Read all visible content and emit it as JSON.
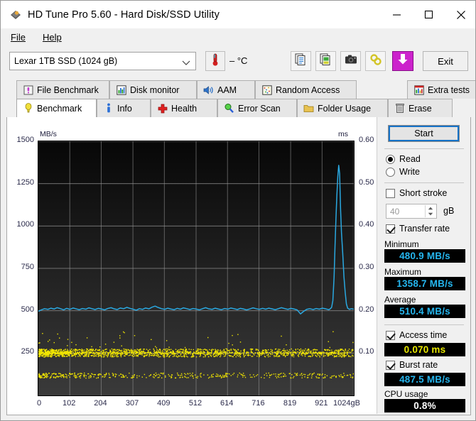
{
  "window": {
    "title": "HD Tune Pro 5.60 - Hard Disk/SSD Utility",
    "app_icon": "hdtune-logo-icon",
    "minimize": "─",
    "maximize": "□",
    "close": "✕"
  },
  "menubar": {
    "items": [
      {
        "label": "File",
        "mnemonic": "F"
      },
      {
        "label": "Help",
        "mnemonic": "H"
      }
    ]
  },
  "toolbar": {
    "drive": {
      "value": "Lexar 1TB SSD (1024 gB)",
      "icon": "chevron-down-icon"
    },
    "temperature": {
      "icon": "thermometer-icon",
      "value": "– °C"
    },
    "buttons": [
      {
        "name": "copy-to-clipboard-button",
        "icon": "copy-document-icon"
      },
      {
        "name": "copy-image-button",
        "icon": "copy-image-icon"
      },
      {
        "name": "screenshot-button",
        "icon": "camera-icon"
      },
      {
        "name": "link-button",
        "icon": "chain-link-icon"
      },
      {
        "name": "save-button",
        "icon": "down-arrow-icon"
      }
    ],
    "exit_label": "Exit"
  },
  "tabs": {
    "row1": [
      {
        "label": "File Benchmark",
        "icon": "file-benchmark-icon",
        "active": false
      },
      {
        "label": "Disk monitor",
        "icon": "bar-chart-icon",
        "active": false
      },
      {
        "label": "AAM",
        "icon": "speaker-icon",
        "active": false
      },
      {
        "label": "Random Access",
        "icon": "scatter-icon",
        "active": false
      },
      {
        "label": "Extra tests",
        "icon": "extra-chart-icon",
        "active": false
      }
    ],
    "row2": [
      {
        "label": "Benchmark",
        "icon": "bulb-icon",
        "active": true
      },
      {
        "label": "Info",
        "icon": "info-icon",
        "active": false
      },
      {
        "label": "Health",
        "icon": "red-cross-icon",
        "active": false
      },
      {
        "label": "Error Scan",
        "icon": "magnifier-icon",
        "active": false
      },
      {
        "label": "Folder Usage",
        "icon": "folder-icon",
        "active": false
      },
      {
        "label": "Erase",
        "icon": "trash-icon",
        "active": false
      }
    ]
  },
  "panel": {
    "start_label": "Start",
    "mode": {
      "read_label": "Read",
      "write_label": "Write",
      "selected": "Read"
    },
    "short_stroke": {
      "label": "Short stroke",
      "checked": false,
      "value": "40",
      "unit": "gB"
    },
    "transfer_rate": {
      "label": "Transfer rate",
      "checked": true
    },
    "results": [
      {
        "label": "Minimum",
        "value": "480.9 MB/s",
        "color": "#25b6ef"
      },
      {
        "label": "Maximum",
        "value": "1358.7 MB/s",
        "color": "#25b6ef"
      },
      {
        "label": "Average",
        "value": "510.4 MB/s",
        "color": "#25b6ef"
      }
    ],
    "access_time": {
      "label": "Access time",
      "checked": true,
      "value": "0.070 ms",
      "color": "#e8e800"
    },
    "burst_rate": {
      "label": "Burst rate",
      "checked": true,
      "value": "487.5 MB/s",
      "color": "#ffffff"
    },
    "cpu_usage": {
      "label": "CPU usage",
      "value": "0.8%",
      "color": "#ffffff"
    }
  },
  "chart_data": {
    "type": "line",
    "title": "",
    "xlabel": "gB",
    "ylabel": "MB/s",
    "y2label": "ms",
    "xlim": [
      0,
      1024
    ],
    "ylim": [
      0,
      1500
    ],
    "y2lim": [
      0,
      0.6
    ],
    "grid": true,
    "legend": "none",
    "background": "#0a0a0a",
    "x_ticks": [
      0,
      102,
      204,
      307,
      409,
      512,
      614,
      716,
      819,
      921,
      1024
    ],
    "x_tick_labels": [
      "0",
      "102",
      "204",
      "307",
      "409",
      "512",
      "614",
      "716",
      "819",
      "921",
      "1024gB"
    ],
    "y_ticks": [
      0,
      250,
      500,
      750,
      1000,
      1250,
      1500
    ],
    "y_tick_labels": [
      "",
      "250",
      "500",
      "750",
      "1000",
      "1250",
      "1500"
    ],
    "y2_ticks": [
      0.0,
      0.1,
      0.2,
      0.3,
      0.4,
      0.5,
      0.6
    ],
    "y2_tick_labels": [
      "",
      "0.10",
      "0.20",
      "0.30",
      "0.40",
      "0.50",
      "0.60"
    ],
    "series": [
      {
        "name": "Transfer rate",
        "type": "line",
        "color": "#2aa8e0",
        "axis": "left",
        "unit": "MB/s",
        "x": [
          0,
          10,
          20,
          31,
          41,
          51,
          61,
          72,
          82,
          92,
          102,
          113,
          123,
          133,
          143,
          154,
          164,
          174,
          184,
          195,
          205,
          215,
          225,
          236,
          246,
          256,
          266,
          277,
          287,
          297,
          307,
          318,
          328,
          338,
          348,
          359,
          369,
          379,
          389,
          400,
          410,
          420,
          430,
          441,
          451,
          461,
          471,
          482,
          492,
          502,
          512,
          523,
          533,
          543,
          553,
          564,
          574,
          584,
          594,
          605,
          615,
          625,
          635,
          646,
          656,
          666,
          676,
          687,
          697,
          707,
          717,
          728,
          738,
          748,
          758,
          769,
          779,
          789,
          799,
          810,
          820,
          830,
          840,
          851,
          861,
          871,
          881,
          892,
          902,
          912,
          922,
          933,
          943,
          948,
          952,
          956,
          960,
          963,
          966,
          969,
          972,
          975,
          978,
          981,
          984,
          988,
          992,
          996,
          1000,
          1004,
          1010,
          1016,
          1024
        ],
        "y": [
          497,
          505,
          512,
          508,
          515,
          510,
          518,
          512,
          505,
          514,
          508,
          516,
          511,
          506,
          513,
          509,
          517,
          512,
          507,
          514,
          510,
          505,
          513,
          518,
          511,
          507,
          516,
          512,
          520,
          514,
          509,
          503,
          512,
          508,
          516,
          511,
          521,
          527,
          519,
          512,
          508,
          515,
          510,
          506,
          514,
          509,
          517,
          512,
          507,
          513,
          510,
          505,
          512,
          518,
          511,
          508,
          515,
          510,
          506,
          513,
          509,
          516,
          512,
          507,
          514,
          510,
          505,
          511,
          517,
          512,
          508,
          514,
          509,
          515,
          511,
          506,
          512,
          518,
          513,
          508,
          514,
          510,
          505,
          481,
          496,
          508,
          512,
          507,
          513,
          509,
          515,
          511,
          506,
          512,
          520,
          560,
          700,
          880,
          1040,
          1180,
          1290,
          1358,
          1310,
          1100,
          960,
          840,
          700,
          610,
          540,
          515,
          508,
          512,
          509
        ],
        "min": 480.9,
        "max": 1358.7,
        "avg": 510.4
      },
      {
        "name": "Access time",
        "type": "scatter",
        "color": "#f2e600",
        "axis": "right",
        "unit": "ms",
        "average": 0.07,
        "clusters": [
          {
            "y_ms": 0.105,
            "density": "dense",
            "x_from": 0,
            "x_to": 1024
          },
          {
            "y_ms": 0.098,
            "density": "dense",
            "x_from": 0,
            "x_to": 1024
          },
          {
            "y_ms": 0.048,
            "density": "medium",
            "x_from": 0,
            "x_to": 1024
          },
          {
            "y_ms": 0.125,
            "density": "sparse",
            "x_from": 0,
            "x_to": 1024
          }
        ]
      }
    ]
  }
}
